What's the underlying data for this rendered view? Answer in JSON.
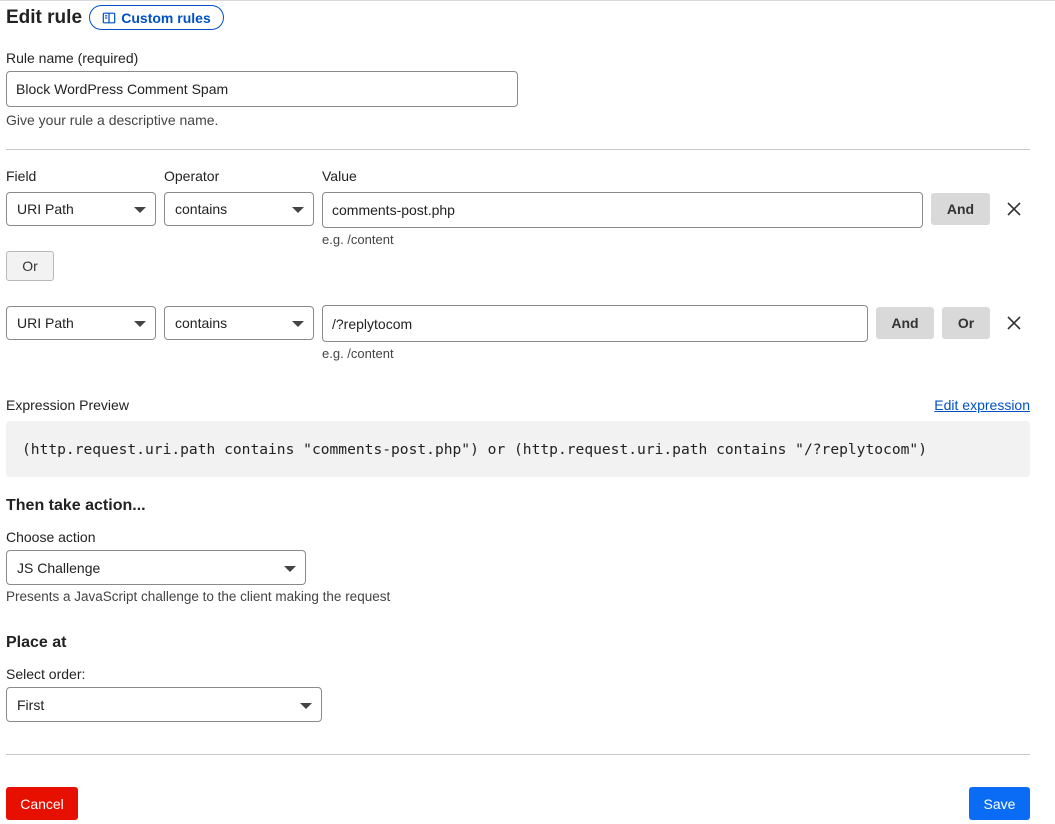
{
  "header": {
    "title": "Edit rule",
    "custom_rules_label": "Custom rules",
    "custom_rules_icon": "book-icon"
  },
  "rule_name": {
    "label": "Rule name (required)",
    "value": "Block WordPress Comment Spam",
    "help": "Give your rule a descriptive name."
  },
  "conditions": {
    "headers": {
      "field": "Field",
      "operator": "Operator",
      "value": "Value"
    },
    "rows": [
      {
        "field": "URI Path",
        "operator": "contains",
        "value": "comments-post.php",
        "hint": "e.g. /content",
        "and_label": "And"
      },
      {
        "field": "URI Path",
        "operator": "contains",
        "value": "/?replytocom",
        "hint": "e.g. /content",
        "and_label": "And",
        "or_label": "Or"
      }
    ],
    "or_separator": "Or"
  },
  "expression": {
    "label": "Expression Preview",
    "edit_link": "Edit expression",
    "text": "(http.request.uri.path contains \"comments-post.php\") or (http.request.uri.path contains \"/?replytocom\")"
  },
  "action": {
    "section_title": "Then take action...",
    "label": "Choose action",
    "value": "JS Challenge",
    "help": "Presents a JavaScript challenge to the client making the request"
  },
  "placement": {
    "section_title": "Place at",
    "label": "Select order:",
    "value": "First"
  },
  "footer": {
    "cancel_label": "Cancel",
    "save_label": "Save"
  },
  "colors": {
    "link": "#0051c3",
    "cancel": "#e70f00",
    "save": "#0a6cf5"
  }
}
